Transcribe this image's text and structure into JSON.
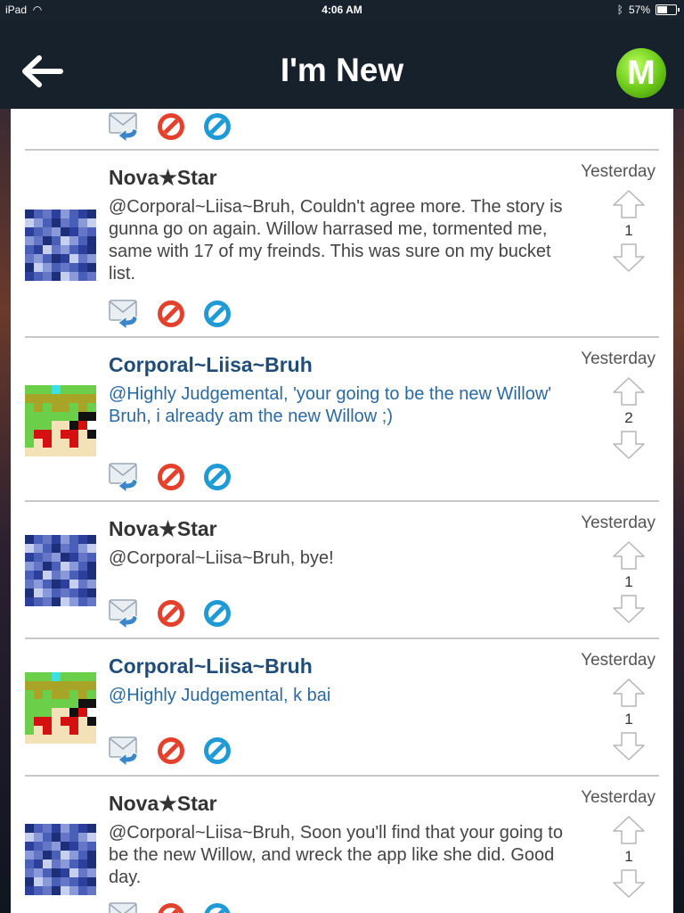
{
  "status_bar": {
    "device": "iPad",
    "time": "4:06 AM",
    "battery": "57%"
  },
  "nav": {
    "title": "I'm New",
    "logo_letter": "M"
  },
  "posts": [
    {
      "author": "Nova★Star",
      "author_style": "dark",
      "date": "Yesterday",
      "text": "@Corporal~Liisa~Bruh, Couldn't agree more. The story is gunna go on again. Willow harrased me, tormented me, same with 17 of my freinds. This was sure on my bucket list.",
      "votes": "1"
    },
    {
      "author": "Corporal~Liisa~Bruh",
      "author_style": "blue",
      "date": "Yesterday",
      "text_lines": [
        "@Highly Judgemental, 'your going to be the new Willow'",
        "Bruh, i already am the new Willow ;)"
      ],
      "votes": "2"
    },
    {
      "author": "Nova★Star",
      "author_style": "dark",
      "date": "Yesterday",
      "text": "@Corporal~Liisa~Bruh, bye!",
      "votes": "1"
    },
    {
      "author": "Corporal~Liisa~Bruh",
      "author_style": "blue",
      "date": "Yesterday",
      "text": "@Highly Judgemental, k bai",
      "votes": "1"
    },
    {
      "author": "Nova★Star",
      "author_style": "dark",
      "date": "Yesterday",
      "text": "@Corporal~Liisa~Bruh, Soon you'll find that your going to be the new Willow, and wreck the app like she did. Good day.",
      "votes": "1"
    }
  ],
  "colors": {
    "nav_bg": "#17212c",
    "author_blue": "#1f4d7a",
    "message_blue": "#2a6aa3",
    "logo_green": "#6ac718",
    "block_red": "#e5402b",
    "hide_blue": "#1e9ad6"
  },
  "icons": {
    "reply": "reply-mail-icon",
    "block": "block-icon",
    "hide": "hide-icon",
    "upvote": "upvote-arrow-icon",
    "downvote": "downvote-arrow-icon",
    "back": "back-arrow-icon"
  }
}
